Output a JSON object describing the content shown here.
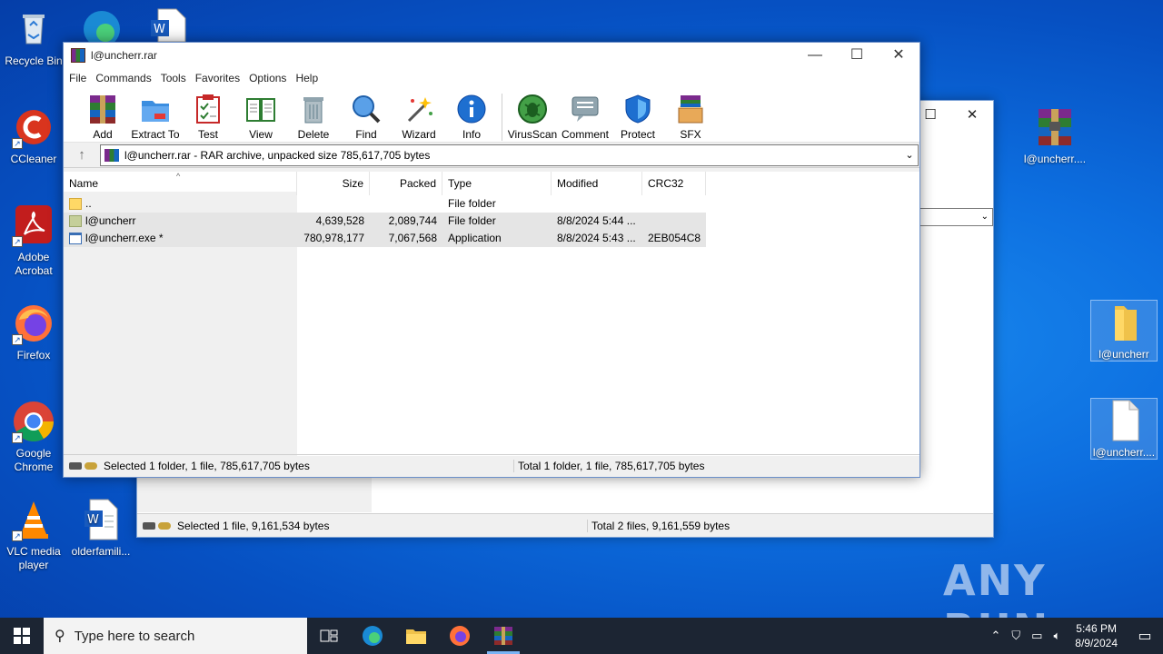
{
  "desktop_icons_left": [
    {
      "label": "Recycle Bin"
    },
    {
      "label": "CCleaner"
    },
    {
      "label": "Adobe Acrobat"
    },
    {
      "label": "Firefox"
    },
    {
      "label": "Google Chrome"
    },
    {
      "label": "VLC media player"
    },
    {
      "label": "olderfamili..."
    }
  ],
  "desktop_icons_right": [
    {
      "label": "l@uncherr...."
    },
    {
      "label": "l@uncherr"
    },
    {
      "label": "l@uncherr...."
    }
  ],
  "window": {
    "title": "l@uncherr.rar",
    "menu": [
      "File",
      "Commands",
      "Tools",
      "Favorites",
      "Options",
      "Help"
    ],
    "toolbar": [
      "Add",
      "Extract To",
      "Test",
      "View",
      "Delete",
      "Find",
      "Wizard",
      "Info",
      "VirusScan",
      "Comment",
      "Protect",
      "SFX"
    ],
    "path": "l@uncherr.rar - RAR archive, unpacked size 785,617,705 bytes",
    "columns": [
      "Name",
      "Size",
      "Packed",
      "Type",
      "Modified",
      "CRC32"
    ],
    "rows": [
      {
        "name": "..",
        "size": "",
        "packed": "",
        "type": "File folder",
        "modified": "",
        "crc": ""
      },
      {
        "name": "l@uncherr",
        "size": "4,639,528",
        "packed": "2,089,744",
        "type": "File folder",
        "modified": "8/8/2024 5:44 ...",
        "crc": ""
      },
      {
        "name": "l@uncherr.exe *",
        "size": "780,978,177",
        "packed": "7,067,568",
        "type": "Application",
        "modified": "8/8/2024 5:43 ...",
        "crc": "2EB054C8"
      }
    ],
    "status_left": "Selected 1 folder, 1 file, 785,617,705 bytes",
    "status_right": "Total 1 folder, 1 file, 785,617,705 bytes"
  },
  "back_window": {
    "status_left": "Selected 1 file, 9,161,534 bytes",
    "status_right": "Total 2 files, 9,161,559 bytes"
  },
  "taskbar": {
    "search_placeholder": "Type here to search",
    "time": "5:46 PM",
    "date": "8/9/2024"
  },
  "watermark": "ANY RUN"
}
